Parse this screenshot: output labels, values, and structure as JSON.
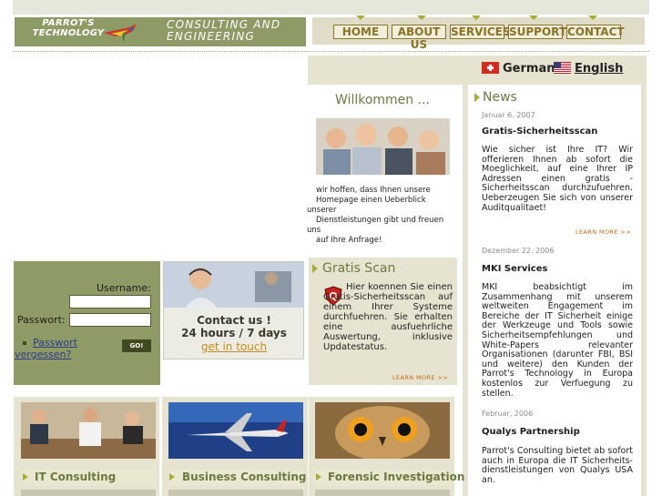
{
  "header": {
    "logo_text": "PARROT'S TECHNOLOGY",
    "tagline": "CONSULTING AND ENGINEERING",
    "nav": [
      "HOME",
      "ABOUT US",
      "SERVICES",
      "SUPPORT",
      "CONTACT"
    ]
  },
  "languages": [
    {
      "label": "German",
      "flag": "swiss-flag-icon"
    },
    {
      "label": "English",
      "flag": "us-flag-icon"
    }
  ],
  "welcome": {
    "title": "Willkommen ...",
    "text_lines": [
      "wir hoffen, dass Ihnen unsere",
      "Homepage einen Ueberblick",
      "unserer",
      "Dienstleistungen gibt und freuen",
      "uns",
      "auf Ihre Anfrage!"
    ]
  },
  "login": {
    "username_label": "Username:",
    "password_label": "Passwort:",
    "forgot_line1": "Passwort",
    "forgot_line2": "vergessen?",
    "go_label": "GO!"
  },
  "contact": {
    "line1": "Contact us !",
    "line2": "24 hours / 7 days",
    "link": "get in touch"
  },
  "gratis": {
    "title": "Gratis Scan",
    "text": "Hier koennen Sie einen Gratis-Sicherheitsscan auf einem Ihrer Systeme durchfuehren. Sie erhalten eine ausfuehrliche Auswertung, inklusive Updatestatus.",
    "learn_more": "LEARN MORE >>"
  },
  "news": {
    "title": "News",
    "items": [
      {
        "date": "Januar 6. 2007",
        "headline": "Gratis-Sicherheitsscan",
        "body": "Wie sicher ist Ihre IT? Wir offerieren Ihnen ab sofort die Moeglichkeit, auf eine Ihrer IP Adressen einen gratis - Sicherheitsscan durchzufuehren. Ueberzeugen Sie sich von unserer Auditqualitaet!",
        "learn_more": "LEARN MORE >>"
      },
      {
        "date": "Dezember 22. 2006",
        "headline": "MKI Services",
        "body": "MKI beabsichtigt im Zusammenhang mit unserem weltweiten Engagement im Bereiche der IT Sicherheit einige der Werkzeuge und Tools sowie Sicherheitsempfehlungen und White-Papers relevanter Organisationen (darunter FBI, BSI und weitere) den Kunden der Parrot's Technology in Europa kostenlos zur Verfuegung zu stellen."
      },
      {
        "date": "Februar, 2006",
        "headline": "Qualys Partnership",
        "body": "Parrot's Consulting bietet ab sofort auch in Europa die IT Sicherheits-dienstleistungen von Qualys USA an."
      }
    ]
  },
  "services": [
    {
      "label": "IT Consulting",
      "photo": "meeting-photo"
    },
    {
      "label": "Business Consulting",
      "photo": "airplane-photo"
    },
    {
      "label": "Forensic Investigation",
      "photo": "owl-photo"
    }
  ],
  "colors": {
    "olive": "#8f9b66",
    "beige": "#e6e3d0",
    "accent_green": "#6c7a40",
    "nav_brown": "#8a7326"
  }
}
